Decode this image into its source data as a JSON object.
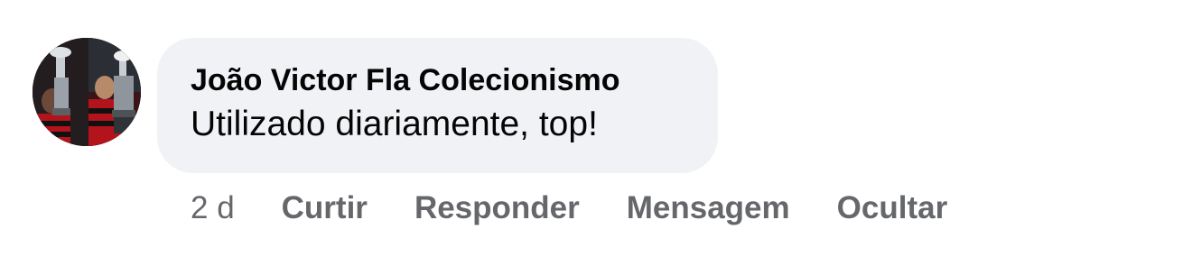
{
  "comment": {
    "author": "João Victor Fla Colecionismo",
    "text": "Utilizado diariamente, top!",
    "time": "2 d",
    "avatar_icon": "trophy-photo-avatar"
  },
  "actions": {
    "like": "Curtir",
    "reply": "Responder",
    "message": "Mensagem",
    "hide": "Ocultar"
  },
  "colors": {
    "bubble": "#f0f2f5",
    "author_text": "#050505",
    "meta_text": "#65676b"
  }
}
